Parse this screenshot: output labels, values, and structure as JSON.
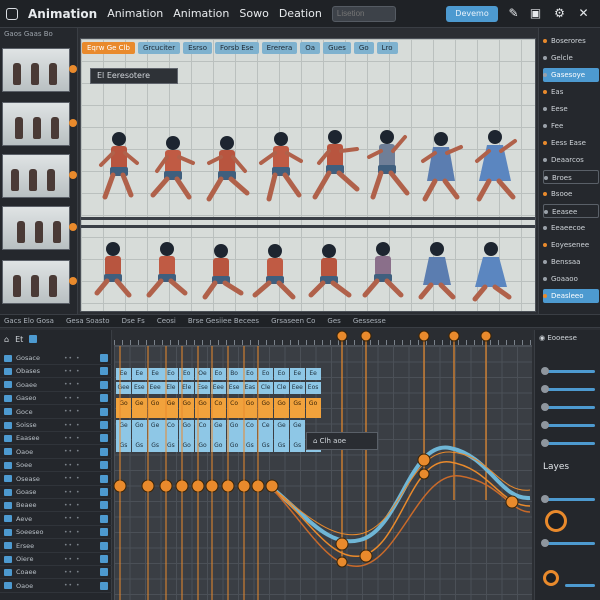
{
  "menubar": {
    "items": [
      "Animation",
      "Animation",
      "Animation",
      "Sowo",
      "Deation"
    ],
    "search_placeholder": "Lisetion",
    "primary_button": "Devemo",
    "icons": [
      "app-icon",
      "pen-icon",
      "edit-icon",
      "settings-icon",
      "close-icon"
    ]
  },
  "left_panel": {
    "header": "Gaos Gaas Bo",
    "thumb_count": 6
  },
  "canvas": {
    "tabs": [
      "Eqrw Ge Clb",
      "Grcuciter",
      "Esrso",
      "Forsb Ese",
      "Ererera",
      "Oa",
      "Gues",
      "Go",
      "Lro"
    ],
    "active_tab": 0,
    "frame_tag": "El Eeresotere",
    "row_count": 2,
    "runner_count": 8
  },
  "right_panel": {
    "items": [
      {
        "label": "Boserores",
        "style": "plain"
      },
      {
        "label": "Gelcle",
        "style": "plain"
      },
      {
        "label": "Gasesoye",
        "style": "highlight"
      },
      {
        "label": "Eas",
        "style": "plain"
      },
      {
        "label": "Eese",
        "style": "plain"
      },
      {
        "label": "Fee",
        "style": "plain"
      },
      {
        "label": "Eess Ease",
        "style": "plain"
      },
      {
        "label": "Deaarcos",
        "style": "plain"
      },
      {
        "label": "Broes",
        "style": "box"
      },
      {
        "label": "Bsooe",
        "style": "plain"
      },
      {
        "label": "Eeasee",
        "style": "box"
      },
      {
        "label": "Eeaeecoe",
        "style": "plain"
      },
      {
        "label": "Eoyesenee",
        "style": "plain"
      },
      {
        "label": "Benssaa",
        "style": "plain"
      },
      {
        "label": "Goaaoo",
        "style": "plain"
      },
      {
        "label": "Deasleeo",
        "style": "highlight"
      }
    ]
  },
  "midbar": {
    "items": [
      "Gacs Elo Gosa",
      "Gesa Soasto",
      "Dse Fs",
      "Ceosi",
      "Brse Gesiiee Becees",
      "Grsaseen Co",
      "Ges",
      "Gessesse"
    ]
  },
  "timeline": {
    "header_label": "Et",
    "layers": [
      "Gosace",
      "Obases",
      "Goaee",
      "Gaseo",
      "Goce",
      "Soisse",
      "Eaasee",
      "Oaoe",
      "Soee",
      "Osease",
      "Goase",
      "Beaee",
      "Aeve",
      "Soeeseo",
      "Ersee",
      "Oiere",
      "Coaee",
      "Oaoe"
    ],
    "tooltip": "Clh aoe",
    "keyframe_row1": [
      "Ee",
      "Ee",
      "Ee",
      "Eo",
      "Eo",
      "Oe",
      "Eo",
      "Bo",
      "Eo",
      "Eo",
      "Eo",
      "Ee",
      "Ee"
    ],
    "keyframe_row2": [
      "Gee",
      "Ese",
      "Eee",
      "Ele",
      "Ele",
      "Ese",
      "Eee",
      "Ese",
      "Eas",
      "Cle",
      "Cle",
      "Eee",
      "Eos"
    ],
    "keyframe_row3": [
      "Go",
      "Ge",
      "Go",
      "Ge",
      "Go",
      "Go",
      "Co",
      "Co",
      "Go",
      "Go",
      "Go",
      "Gs",
      "Go"
    ],
    "keyframe_row4": [
      "Ge",
      "Go",
      "Ge",
      "Co",
      "Go",
      "Co",
      "Ge",
      "Go",
      "Co",
      "Ce",
      "Ge",
      "Ge"
    ],
    "keyframe_row5": [
      "Gs",
      "Gs",
      "Gs",
      "Gs",
      "Go",
      "Go",
      "Go",
      "Go",
      "Gs",
      "Gs",
      "Gs",
      "Gs",
      "Gs"
    ],
    "curve_colors": [
      "#6fb6d6",
      "#e98a2c",
      "#c96a2a"
    ]
  },
  "right_bottom": {
    "header": "Eooeese",
    "layers_title": "Layes"
  },
  "colors": {
    "accent": "#e98a2c",
    "blue": "#4d9ad0",
    "panel": "#24272c"
  }
}
